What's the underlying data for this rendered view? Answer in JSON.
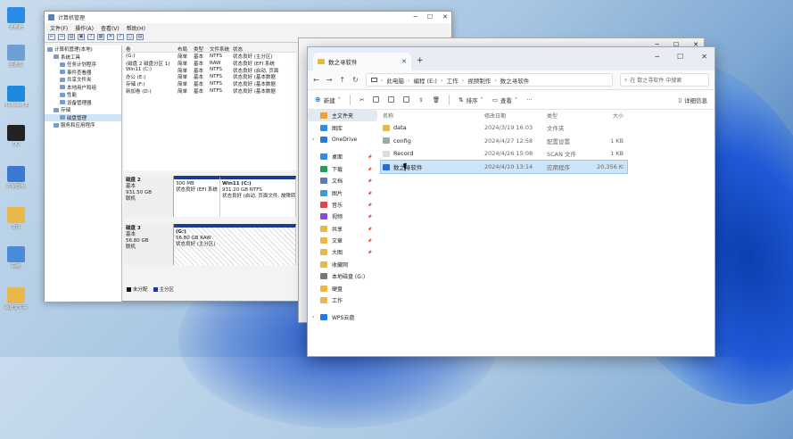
{
  "colors": {
    "accent": "#0067c0",
    "folder": "#e8b94a",
    "disk_bar": "#1e3c8f"
  },
  "desktop": {
    "icons": [
      {
        "label": "此电脑",
        "icon": "monitor-icon",
        "color": "#2a8ce6"
      },
      {
        "label": "回收站",
        "icon": "recycle-bin-icon",
        "color": "#6d9fd4"
      },
      {
        "label": "Microsoft Edge",
        "icon": "edge-icon",
        "color": "#1b8ae0"
      },
      {
        "label": "QQ",
        "icon": "qq-icon",
        "color": "#222"
      },
      {
        "label": "控制面板",
        "icon": "control-panel-icon",
        "color": "#3b78d0"
      },
      {
        "label": "文件",
        "icon": "folder-icon",
        "color": "#e8b94a"
      },
      {
        "label": "网络",
        "icon": "network-icon",
        "color": "#4a8ad8"
      },
      {
        "label": "新建文件夹",
        "icon": "folder-icon",
        "color": "#e8b94a"
      }
    ]
  },
  "mmc": {
    "title": "计算机管理",
    "menu": [
      "文件(F)",
      "操作(A)",
      "查看(V)",
      "帮助(H)"
    ],
    "toolbar": [
      "←",
      "→",
      "▤",
      "▣",
      "?",
      "▦",
      "✕",
      "✓",
      "▢",
      "▤"
    ],
    "tree": [
      {
        "label": "计算机管理(本地)",
        "indent": 0
      },
      {
        "label": "系统工具",
        "indent": 1
      },
      {
        "label": "任务计划程序",
        "indent": 2
      },
      {
        "label": "事件查看器",
        "indent": 2
      },
      {
        "label": "共享文件夹",
        "indent": 2
      },
      {
        "label": "本地用户和组",
        "indent": 2
      },
      {
        "label": "性能",
        "indent": 2
      },
      {
        "label": "设备管理器",
        "indent": 2
      },
      {
        "label": "存储",
        "indent": 1
      },
      {
        "label": "磁盘管理",
        "indent": 2,
        "selected": true
      },
      {
        "label": "服务和应用程序",
        "indent": 1
      }
    ],
    "volume_headers": [
      "卷",
      "布局",
      "类型",
      "文件系统",
      "状态"
    ],
    "volumes": [
      [
        "(G:)",
        "简单",
        "基本",
        "NTFS",
        "状态良好 (主分区)"
      ],
      [
        "(磁盘 2 磁盘分区 1)",
        "简单",
        "基本",
        "RAW",
        "状态良好 (EFI 系统"
      ],
      [
        "Win11 (C:)",
        "简单",
        "基本",
        "NTFS",
        "状态良好 (启动, 页面"
      ],
      [
        "办公 (E:)",
        "简单",
        "基本",
        "NTFS",
        "状态良好 (基本数据"
      ],
      [
        "存储 (F:)",
        "简单",
        "基本",
        "NTFS",
        "状态良好 (基本数据"
      ],
      [
        "新加卷 (D:)",
        "简单",
        "基本",
        "NTFS",
        "状态良好 (基本数据"
      ]
    ],
    "disks": [
      {
        "name": "磁盘 2",
        "type": "基本",
        "size": "931.50 GB",
        "status": "联机",
        "parts": [
          {
            "l1": "",
            "l2": "300 MB",
            "l3": "状态良好 (EFI 系统"
          },
          {
            "l1": "Win11  (C:)",
            "l2": "931.20 GB NTFS",
            "l3": "状态良好 (启动, 页面文件, 故障转储"
          }
        ]
      },
      {
        "name": "磁盘 3",
        "type": "基本",
        "size": "56.80 GB",
        "status": "联机",
        "parts": [
          {
            "l1": "(G:)",
            "l2": "56.80 GB RAW",
            "l3": "状态良好 (主分区)"
          }
        ]
      }
    ],
    "legend": [
      "未分配",
      "主分区"
    ]
  },
  "explorer": {
    "tab_title": "数之寻软件",
    "new_tab": "+",
    "breadcrumb": [
      "此电脑",
      "编程 (E:)",
      "工作",
      "视频制作",
      "数之寻软件"
    ],
    "search_placeholder": "在 数之寻软件 中搜索",
    "commands": {
      "new": "新建",
      "sort": "排序",
      "view": "查看",
      "more": "···",
      "details": "详细信息"
    },
    "nav": [
      {
        "label": "主文件夹",
        "icon": "home-icon",
        "color": "#e8a33a",
        "sel": true
      },
      {
        "label": "图库",
        "icon": "gallery-icon",
        "color": "#3a8bd8"
      },
      {
        "label": "OneDrive",
        "icon": "cloud-icon",
        "color": "#2a7ad8",
        "caret": true
      },
      {
        "label": "桌面",
        "icon": "desktop-icon",
        "color": "#3a8bd8",
        "pin": true
      },
      {
        "label": "下载",
        "icon": "download-icon",
        "color": "#2a9a5a",
        "pin": true
      },
      {
        "label": "文档",
        "icon": "document-icon",
        "color": "#5a7ab8",
        "pin": true
      },
      {
        "label": "图片",
        "icon": "picture-icon",
        "color": "#3a9ad8",
        "pin": true
      },
      {
        "label": "音乐",
        "icon": "music-icon",
        "color": "#d84a4a",
        "pin": true
      },
      {
        "label": "视频",
        "icon": "video-icon",
        "color": "#8a4ad8",
        "pin": true
      },
      {
        "label": "共享",
        "icon": "folder-icon",
        "color": "#e8b94a",
        "pin": true
      },
      {
        "label": "文章",
        "icon": "folder-icon",
        "color": "#e8b94a",
        "pin": true
      },
      {
        "label": "大图",
        "icon": "folder-icon",
        "color": "#e8b94a",
        "pin": true
      },
      {
        "label": "收藏网",
        "icon": "folder-icon",
        "color": "#e8b94a"
      },
      {
        "label": "本地磁盘 (G:)",
        "icon": "drive-icon",
        "color": "#777"
      },
      {
        "label": "硬盘",
        "icon": "folder-icon",
        "color": "#e8b94a"
      },
      {
        "label": "工作",
        "icon": "folder-icon",
        "color": "#e8b94a"
      },
      {
        "label": "WPS云盘",
        "icon": "cloud-icon",
        "color": "#2a7ad8",
        "caret": true
      }
    ],
    "columns": [
      "名称",
      "修改日期",
      "类型",
      "大小"
    ],
    "files": [
      {
        "name": "data",
        "date": "2024/3/19 16:03",
        "type": "文件夹",
        "size": "",
        "icon": "folder-icon",
        "color": "#e8b94a"
      },
      {
        "name": "config",
        "date": "2024/4/27 12:58",
        "type": "配置设置",
        "size": "1 KB",
        "icon": "config-icon",
        "color": "#9aa"
      },
      {
        "name": "Record",
        "date": "2024/4/26 15:08",
        "type": "SCAN 文件",
        "size": "1 KB",
        "icon": "file-icon",
        "color": "#ddd"
      },
      {
        "name": "数之寻软件",
        "date": "2024/4/10 13:14",
        "type": "应用程序",
        "size": "20,356 KB",
        "icon": "app-icon",
        "color": "#2a6ad8",
        "sel": true
      }
    ]
  }
}
